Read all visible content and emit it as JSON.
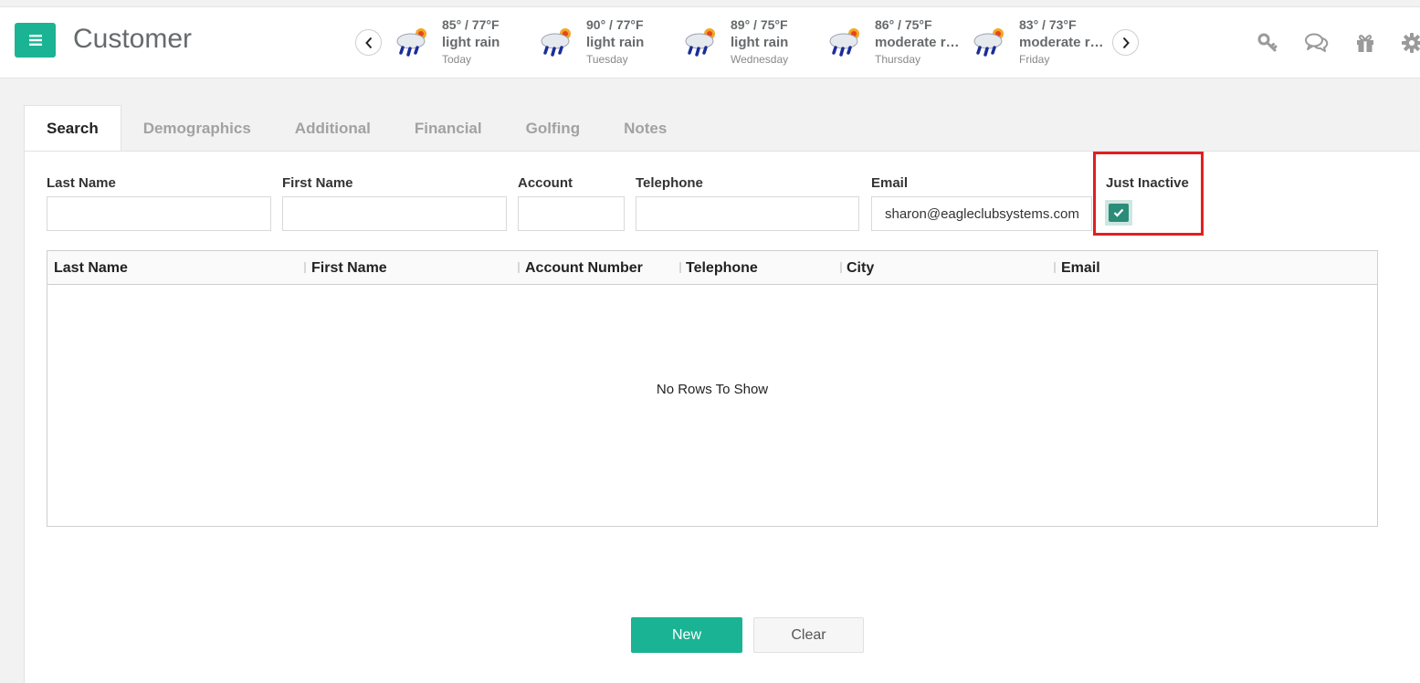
{
  "header": {
    "title": "Customer",
    "weather": [
      {
        "temp": "85° / 77°F",
        "desc": "light rain",
        "day": "Today"
      },
      {
        "temp": "90° / 77°F",
        "desc": "light rain",
        "day": "Tuesday"
      },
      {
        "temp": "89° / 75°F",
        "desc": "light rain",
        "day": "Wednesday"
      },
      {
        "temp": "86° / 75°F",
        "desc": "moderate rain",
        "day": "Thursday"
      },
      {
        "temp": "83° / 73°F",
        "desc": "moderate rain",
        "day": "Friday"
      }
    ]
  },
  "tabs": [
    "Search",
    "Demographics",
    "Additional",
    "Financial",
    "Golfing",
    "Notes"
  ],
  "form": {
    "last_name": {
      "label": "Last Name",
      "value": ""
    },
    "first_name": {
      "label": "First Name",
      "value": ""
    },
    "account": {
      "label": "Account",
      "value": ""
    },
    "telephone": {
      "label": "Telephone",
      "value": ""
    },
    "email": {
      "label": "Email",
      "value": "sharon@eagleclubsystems.com"
    },
    "just_inactive": {
      "label": "Just Inactive",
      "checked": true
    }
  },
  "grid": {
    "columns": [
      "Last Name",
      "First Name",
      "Account Number",
      "Telephone",
      "City",
      "Email"
    ],
    "empty_text": "No Rows To Show"
  },
  "buttons": {
    "new": "New",
    "clear": "Clear"
  },
  "colors": {
    "accent": "#1ab394",
    "checkbox": "#2a8c79",
    "highlight": "#e02020"
  }
}
